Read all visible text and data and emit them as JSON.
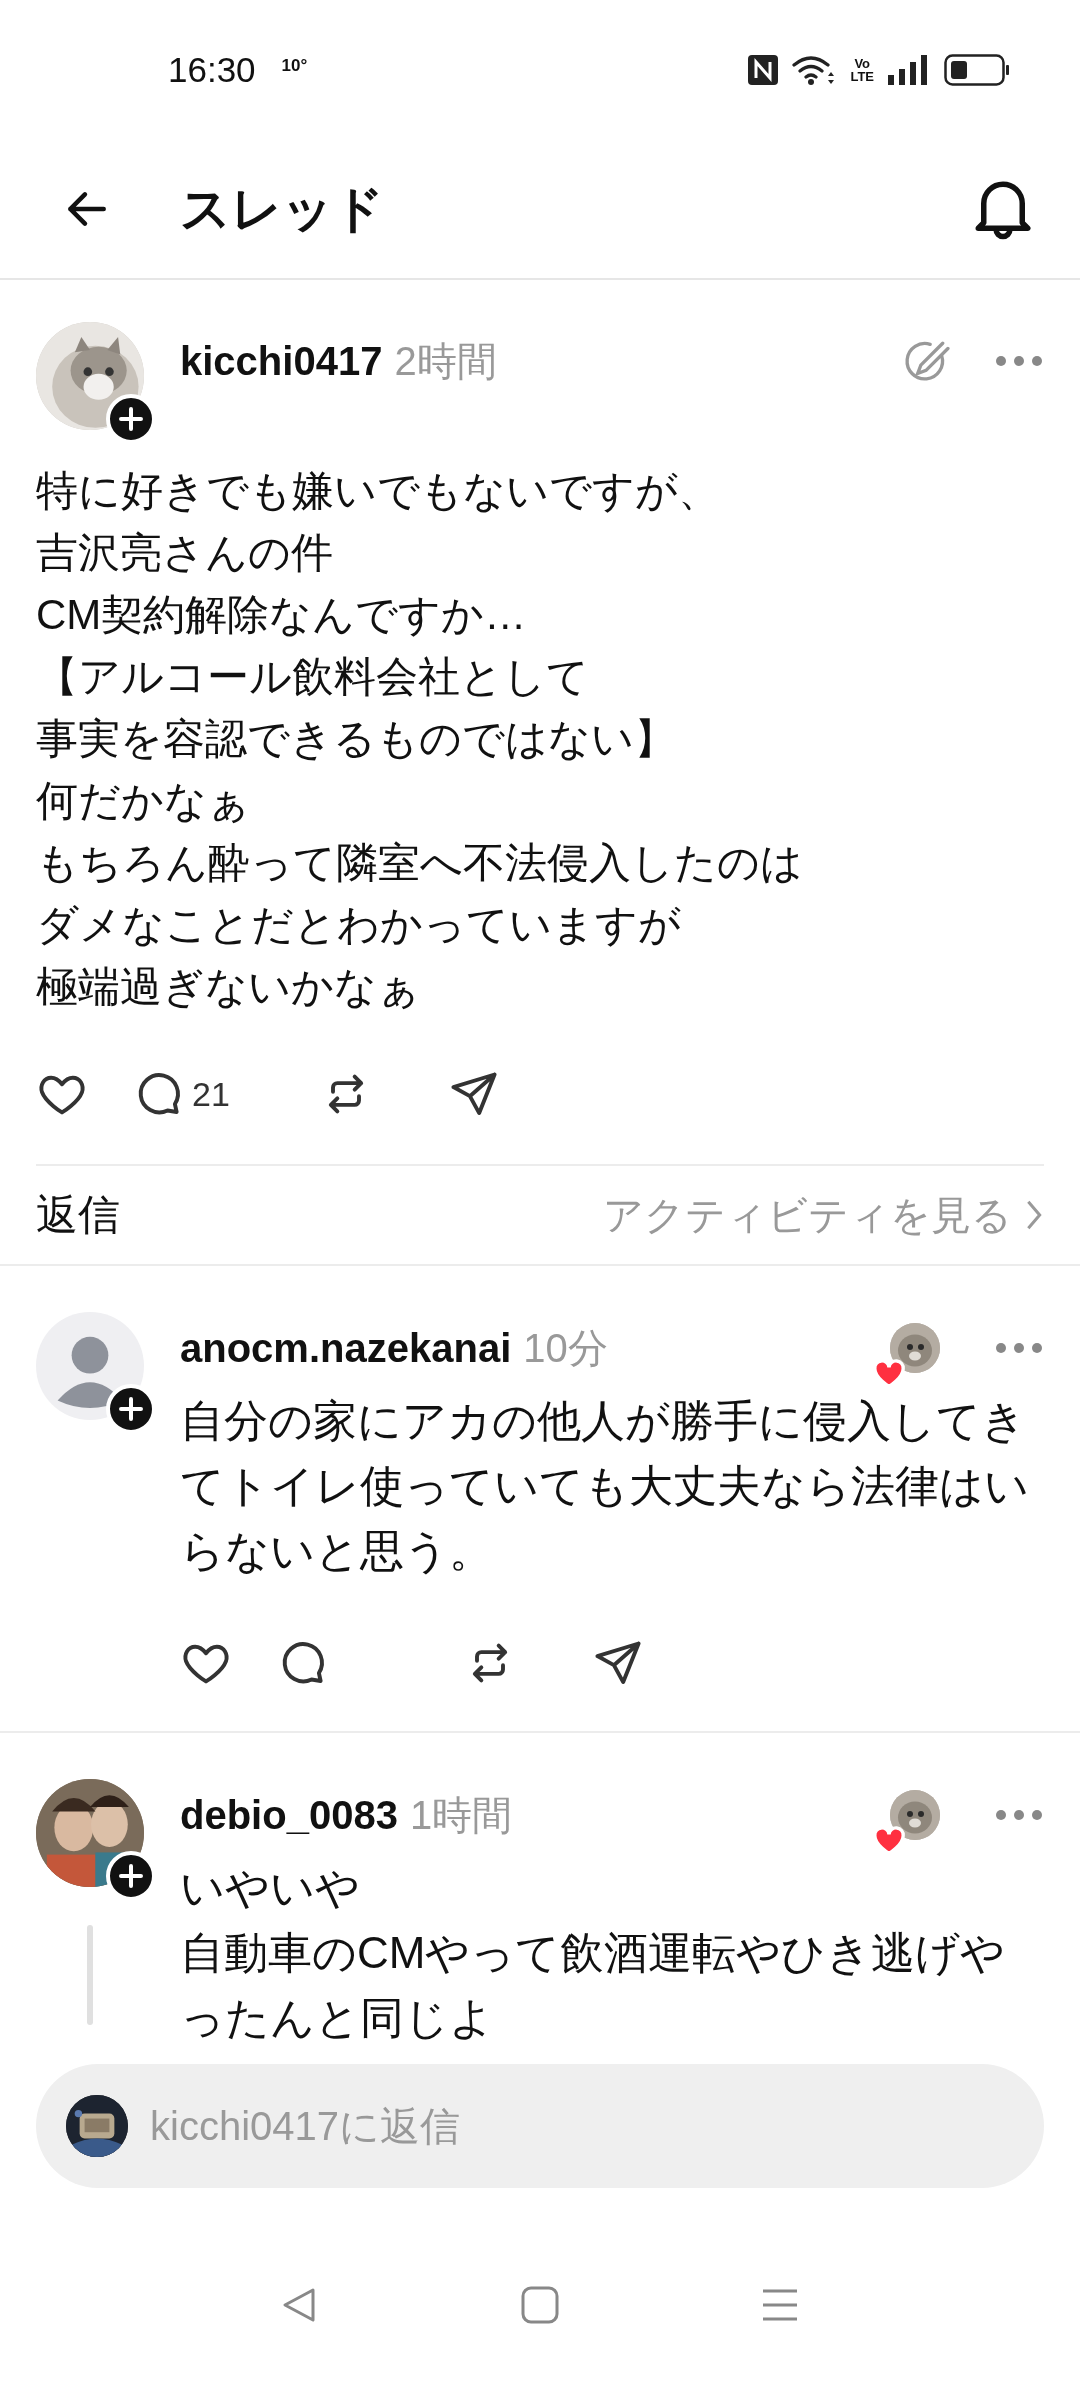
{
  "status_bar": {
    "time": "16:30",
    "temperature": "10°",
    "network": [
      "Vo",
      "LTE"
    ]
  },
  "header": {
    "title": "スレッド"
  },
  "post": {
    "username": "kicchi0417",
    "time": "2時間",
    "body_lines": [
      "特に好きでも嫌いでもないですが、",
      "吉沢亮さんの件",
      "CM契約解除なんですか…",
      "【アルコール飲料会社として",
      "事実を容認できるものではない】",
      "何だかなぁ",
      "もちろん酔って隣室へ不法侵入したのは",
      "ダメなことだとわかっていますが",
      "極端過ぎないかなぁ"
    ],
    "liked": false,
    "reply_count": "21"
  },
  "replies_header": {
    "label": "返信",
    "activity_link": "アクティビティを見る"
  },
  "replies": [
    {
      "username": "anocm.nazekanai",
      "time": "10分",
      "avatar": {
        "kind": "default"
      },
      "text_lines": [
        "自分の家にアカの他人が勝手に侵入してきてトイレ使っていても大丈夫なら法律はいらないと思う。"
      ],
      "liked": false,
      "liked_by_author": true,
      "thread_line": false
    },
    {
      "username": "debio_0083",
      "time": "1時間",
      "text_lines": [
        "いやいや",
        "自動車のCMやって飲酒運転やひき逃げや",
        "ったんと同じよ"
      ],
      "liked_by_author": true,
      "thread_line": true
    }
  ],
  "reply_field": {
    "placeholder": "kicchi0417に返信"
  }
}
